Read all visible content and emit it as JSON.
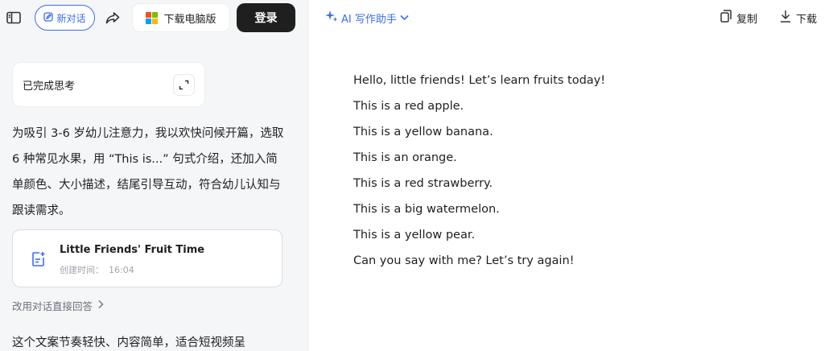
{
  "topbar": {
    "new_chat_label": "新对话",
    "download_pc_label": "下载电脑版",
    "login_label": "登录"
  },
  "thinking": {
    "label": "已完成思考"
  },
  "summary": "为吸引 3-6 岁幼儿注意力，我以欢快问候开篇，选取 6 种常见水果，用 “This is...” 句式介绍，还加入简单颜色、大小描述，结尾引导互动，符合幼儿认知与跟读需求。",
  "doc_card": {
    "title": "Little Friends' Fruit Time",
    "created_label": "创建时间：",
    "created_time": "16:04"
  },
  "switch_answer_label": "改用对话直接回答",
  "bottom_text": "这个文案节奏轻快、内容简单，适合短视频呈",
  "right_header": {
    "assistant_label": "AI 写作助手",
    "copy_label": "复制",
    "download_label": "下载"
  },
  "document_lines": [
    "Hello, little friends! Let’s learn fruits today!",
    "This is a red apple.",
    "This is a yellow banana.",
    "This is an orange.",
    "This is a red strawberry.",
    "This is a big watermelon.",
    "This is a yellow pear.",
    "Can you say with me? Let’s try again!"
  ],
  "colors": {
    "accent": "#3b6cf6",
    "login_bg": "#1f1f1f",
    "panel_bg": "#f5f6f8",
    "ms_red": "#f25022",
    "ms_green": "#7fba00",
    "ms_blue": "#00a4ef",
    "ms_yellow": "#ffb900"
  }
}
